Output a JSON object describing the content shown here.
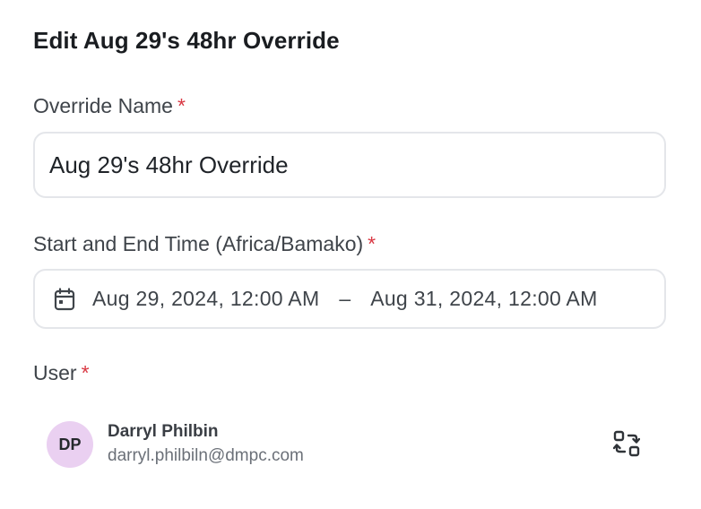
{
  "form": {
    "title": "Edit Aug 29's 48hr Override",
    "required_marker": "*",
    "override_name": {
      "label": "Override Name",
      "value": "Aug 29's 48hr Override"
    },
    "time_range": {
      "label": "Start and End Time (Africa/Bamako)",
      "start": "Aug 29, 2024, 12:00 AM",
      "separator": "–",
      "end": "Aug 31, 2024, 12:00 AM",
      "icon": "calendar-icon"
    },
    "user": {
      "label": "User",
      "initials": "DP",
      "name": "Darryl Philbin",
      "email": "darryl.philbiln@dmpc.com",
      "avatar_color": "#ead0f1",
      "swap_icon": "swap-user-icon"
    }
  },
  "colors": {
    "required": "#d93843",
    "border": "#e4e6ea"
  }
}
